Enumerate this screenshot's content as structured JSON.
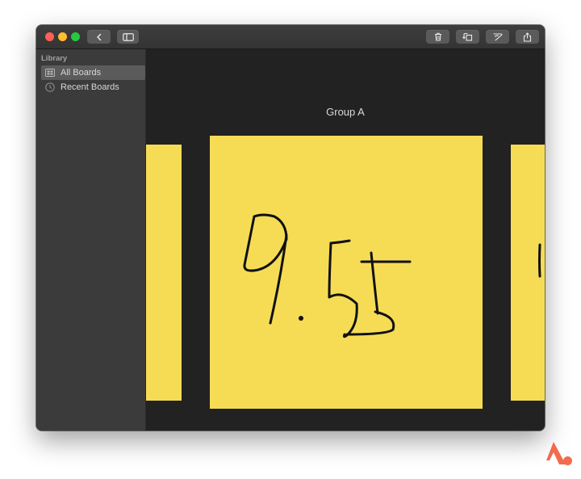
{
  "sidebar": {
    "header": "Library",
    "items": [
      {
        "label": "All Boards",
        "icon": "grid-icon",
        "selected": true
      },
      {
        "label": "Recent Boards",
        "icon": "clock-icon",
        "selected": false
      }
    ]
  },
  "toolbar": {
    "buttons": [
      "back-icon",
      "sidebar-toggle-icon",
      "trash-icon",
      "rotate-icon",
      "pen-icon",
      "share-icon"
    ]
  },
  "main": {
    "group_title": "Group A"
  },
  "colors": {
    "note_yellow": "#f6dc55",
    "canvas_bg": "#222222",
    "sidebar_bg": "#3b3b3b",
    "logo_accent": "#f26b4e"
  }
}
